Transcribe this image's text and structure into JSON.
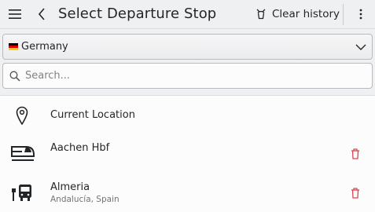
{
  "header": {
    "title": "Select Departure Stop",
    "clear_history_label": "Clear history",
    "menu_icon": "hamburger-menu-icon",
    "back_icon": "chevron-left-icon",
    "clear_icon": "clear-history-icon",
    "more_icon": "kebab-menu-icon"
  },
  "country": {
    "selected": "Germany",
    "flag_colors": [
      "#000000",
      "#dd0000",
      "#ffce00"
    ]
  },
  "search": {
    "placeholder": "Search...",
    "value": ""
  },
  "list": {
    "items": [
      {
        "name": "Current Location",
        "subtitle": "",
        "icon": "location-pin-icon",
        "deletable": false
      },
      {
        "name": "Aachen Hbf",
        "subtitle": "",
        "icon": "train-icon",
        "deletable": true
      },
      {
        "name": "Almeria",
        "subtitle": "Andalucía, Spain",
        "icon": "bus-stop-icon",
        "deletable": true
      }
    ]
  },
  "colors": {
    "delete_accent": "#da4453",
    "text": "#232629",
    "secondary_text": "#707478"
  }
}
